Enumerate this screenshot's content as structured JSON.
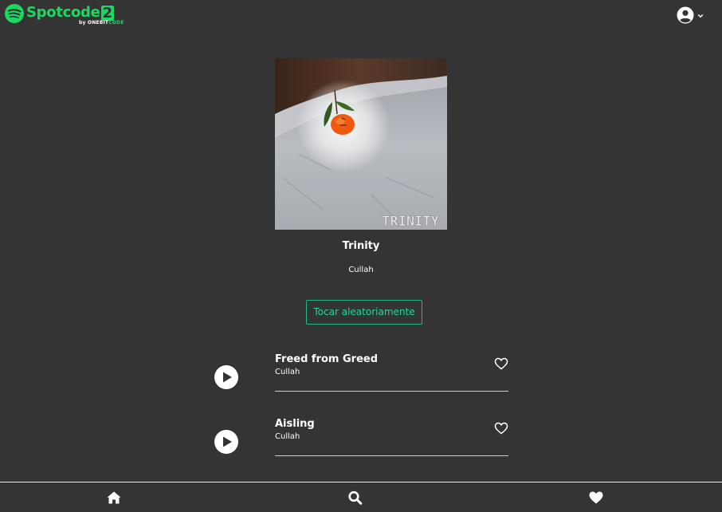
{
  "app": {
    "logo_word": "Spotcode",
    "logo_number": "2",
    "logo_sub_by": "by",
    "logo_sub_brand_a": "ONEBIT",
    "logo_sub_brand_b": "CODE",
    "brand_color": "#1ed760"
  },
  "header": {
    "user_icon": "user-circle-icon",
    "dropdown_icon": "chevron-down-icon"
  },
  "album": {
    "title": "Trinity",
    "artist": "Cullah",
    "cover_text": "TRINITY",
    "shuffle_label": "Tocar aleatoriamente"
  },
  "tracks": [
    {
      "name": "Freed from Greed",
      "artist": "Cullah",
      "favorite": false
    },
    {
      "name": "Aisling",
      "artist": "Cullah",
      "favorite": false
    }
  ],
  "bottom_nav": {
    "items": [
      {
        "icon": "home-icon"
      },
      {
        "icon": "search-icon"
      },
      {
        "icon": "heart-icon"
      }
    ]
  },
  "colors": {
    "background": "#343434",
    "accent": "#1db982",
    "text": "#ffffff"
  }
}
